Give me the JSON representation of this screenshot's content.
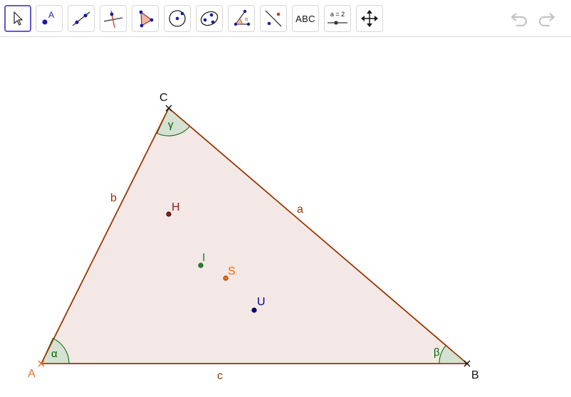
{
  "toolbar": {
    "tools": [
      {
        "name": "move-tool"
      },
      {
        "name": "point-tool",
        "label": "A"
      },
      {
        "name": "line-tool"
      },
      {
        "name": "perpendicular-line-tool"
      },
      {
        "name": "polygon-tool"
      },
      {
        "name": "circle-center-point-tool"
      },
      {
        "name": "conic-tool"
      },
      {
        "name": "angle-tool"
      },
      {
        "name": "reflect-about-line-tool"
      },
      {
        "name": "text-tool",
        "label": "ABC"
      },
      {
        "name": "slider-tool",
        "label": "a = 2"
      },
      {
        "name": "move-graphics-view-tool"
      }
    ],
    "undo": "undo-icon",
    "redo": "redo-icon"
  },
  "triangle": {
    "vertices": {
      "A": "A",
      "B": "B",
      "C": "C"
    },
    "sides": {
      "a": "a",
      "b": "b",
      "c": "c"
    },
    "angles": {
      "alpha": "α",
      "beta": "β",
      "gamma": "γ"
    },
    "special_points": {
      "H": "H",
      "I": "I",
      "S": "S",
      "U": "U"
    }
  },
  "colors": {
    "triangle_fill": "#f3e8e5",
    "triangle_edge": "#993300",
    "angle_fill": "#cfdfcf",
    "angle_edge": "#006400",
    "label_A": "#e8702a",
    "label_H": "#8b1a1a",
    "label_I": "#2e7d32",
    "label_S": "#ff6600",
    "label_U": "#00008b",
    "toolbar_selected": "#6557d2"
  }
}
